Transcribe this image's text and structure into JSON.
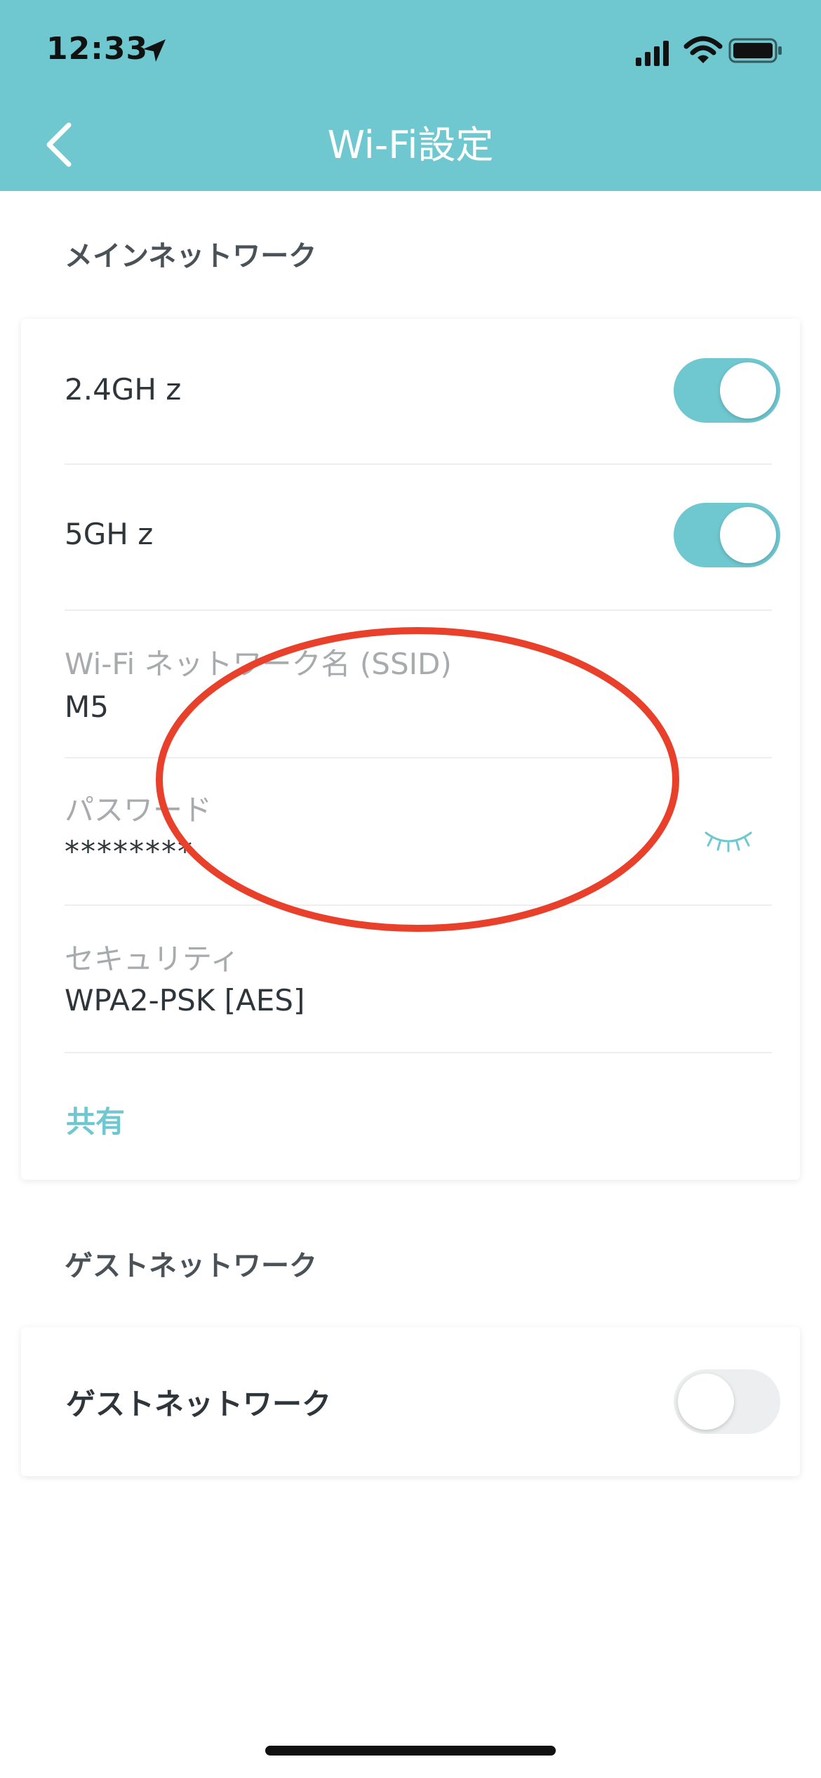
{
  "status_bar": {
    "time": "12:33"
  },
  "header": {
    "title": "Wi-Fi設定"
  },
  "main_network": {
    "section_label": "メインネットワーク",
    "band_24": {
      "label": "2.4GH z",
      "enabled": true
    },
    "band_5": {
      "label": "5GH z",
      "enabled": true
    },
    "ssid": {
      "label": "Wi-Fi ネットワーク名 (SSID)",
      "value": "M5"
    },
    "password": {
      "label": "パスワード",
      "value": "********"
    },
    "security": {
      "label": "セキュリティ",
      "value": "WPA2-PSK [AES]"
    },
    "share_label": "共有"
  },
  "guest_network": {
    "section_label": "ゲストネットワーク",
    "toggle_label": "ゲストネットワーク",
    "enabled": false
  },
  "colors": {
    "accent": "#6fc7d0",
    "annotation": "#e8402a"
  },
  "icons": [
    "location-arrow-icon",
    "cellular-signal-icon",
    "wifi-icon",
    "battery-icon",
    "back-chevron-icon",
    "eye-closed-icon"
  ]
}
